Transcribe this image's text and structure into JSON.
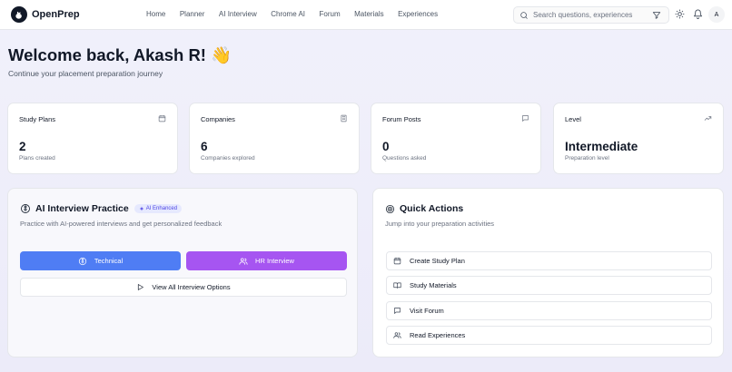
{
  "header": {
    "brand": "OpenPrep",
    "nav": [
      "Home",
      "Planner",
      "AI Interview",
      "Chrome AI",
      "Forum",
      "Materials",
      "Experiences"
    ],
    "search_placeholder": "Search questions, experiences",
    "avatar_initial": "A"
  },
  "welcome": {
    "title": "Welcome back, Akash R! 👋",
    "subtitle": "Continue your placement preparation journey"
  },
  "stats": [
    {
      "title": "Study Plans",
      "value": "2",
      "caption": "Plans created",
      "icon": "calendar-icon"
    },
    {
      "title": "Companies",
      "value": "6",
      "caption": "Companies explored",
      "icon": "building-icon"
    },
    {
      "title": "Forum Posts",
      "value": "0",
      "caption": "Questions asked",
      "icon": "message-icon"
    },
    {
      "title": "Level",
      "value": "Intermediate",
      "caption": "Preparation level",
      "icon": "trending-up-icon"
    }
  ],
  "ai_interview": {
    "title": "AI Interview Practice",
    "badge": "AI Enhanced",
    "description": "Practice with AI-powered interviews and get personalized feedback",
    "technical_label": "Technical",
    "hr_label": "HR Interview",
    "view_all_label": "View All Interview Options",
    "colors": {
      "technical": "#4f7df4",
      "hr": "#a655f1"
    }
  },
  "quick_actions": {
    "title": "Quick Actions",
    "description": "Jump into your preparation activities",
    "items": [
      {
        "label": "Create Study Plan",
        "icon": "calendar-icon"
      },
      {
        "label": "Study Materials",
        "icon": "book-icon"
      },
      {
        "label": "Visit Forum",
        "icon": "message-icon"
      },
      {
        "label": "Read Experiences",
        "icon": "users-icon"
      }
    ]
  }
}
